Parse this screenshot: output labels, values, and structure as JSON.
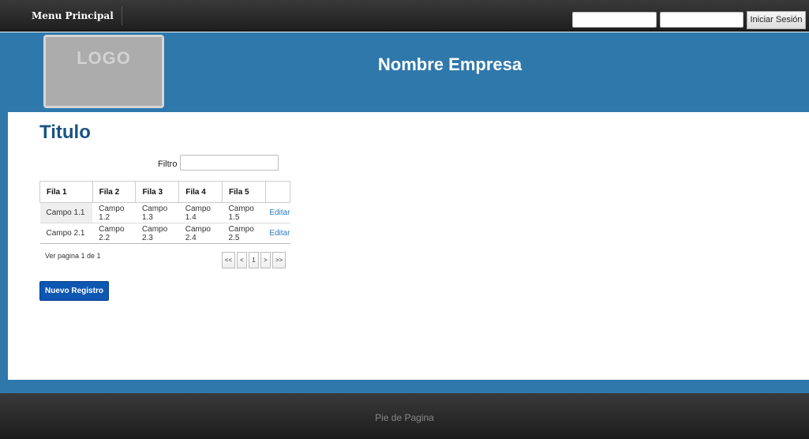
{
  "topbar": {
    "menu_label": "Menu Principal",
    "login_button": "Iniciar Sesión"
  },
  "header": {
    "logo_text": "LOGO",
    "company_name": "Nombre Empresa"
  },
  "main": {
    "title": "Titulo",
    "filter_label": "Filtro",
    "table": {
      "headers": [
        "Fila 1",
        "Fila 2",
        "Fila 3",
        "Fila 4",
        "Fila 5",
        ""
      ],
      "rows": [
        [
          "Campo 1.1",
          "Campo 1.2",
          "Campo 1.3",
          "Campo 1.4",
          "Campo 1.5",
          "Editar"
        ],
        [
          "Campo 2.1",
          "Campo 2.2",
          "Campo 2.3",
          "Campo 2.4",
          "Campo 2.5",
          "Editar"
        ]
      ]
    },
    "page_info": "Ver pagina 1 de 1",
    "pager": {
      "first": "<<",
      "prev": "<",
      "current": "1",
      "next": ">",
      "last": ">>"
    },
    "new_button": "Nuevo Registro"
  },
  "footer": {
    "text": "Pie de Pagina"
  },
  "colors": {
    "header_blue": "#2f78ab",
    "title_blue": "#1a5384",
    "button_blue": "#0d57b3",
    "link_blue": "#2a7bc0"
  }
}
